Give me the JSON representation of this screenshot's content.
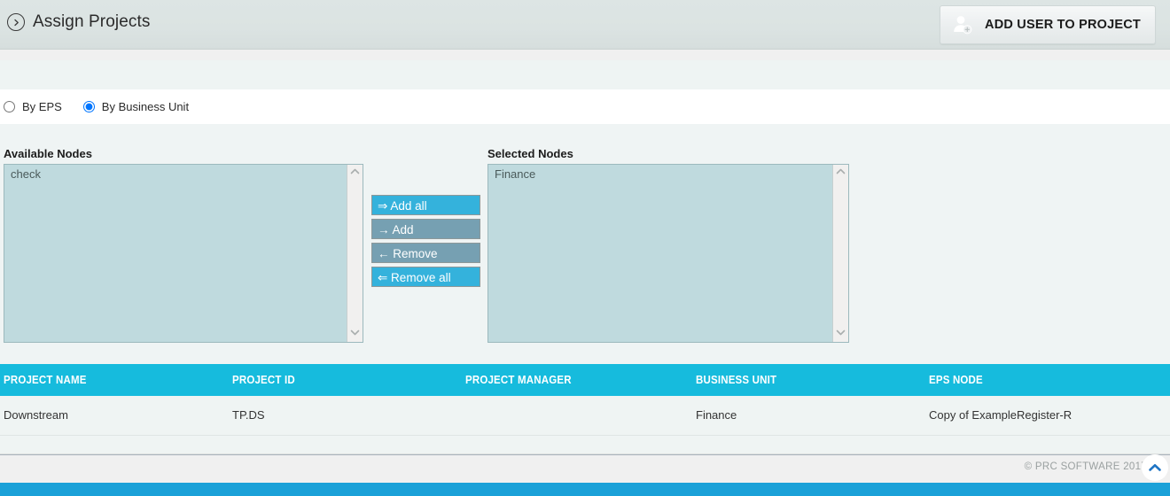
{
  "header": {
    "title": "Assign Projects",
    "back_icon": "chevron-right-circle-icon",
    "add_user_button": {
      "label": "ADD USER TO PROJECT",
      "icon": "add-user-icon"
    }
  },
  "filter": {
    "options": [
      {
        "label": "By EPS",
        "selected": false
      },
      {
        "label": "By Business Unit",
        "selected": true
      }
    ]
  },
  "transfer": {
    "available": {
      "label": "Available Nodes",
      "options": [
        "check"
      ]
    },
    "selected": {
      "label": "Selected Nodes",
      "options": [
        "Finance"
      ]
    },
    "buttons": [
      {
        "label": "⇒ Add all",
        "style": "primary"
      },
      {
        "label": "→ Add",
        "style": "muted"
      },
      {
        "label": "← Remove",
        "style": "muted"
      },
      {
        "label": "⇐ Remove all",
        "style": "primary"
      }
    ],
    "scrollbar": {
      "up_icon": "chevron-up-icon",
      "down_icon": "chevron-down-icon"
    }
  },
  "table": {
    "columns": [
      "PROJECT NAME",
      "PROJECT ID",
      "PROJECT MANAGER",
      "BUSINESS UNIT",
      "EPS NODE"
    ],
    "rows": [
      {
        "project_name": "Downstream",
        "project_id": "TP.DS",
        "project_manager": "",
        "business_unit": "Finance",
        "eps_node": "Copy of ExampleRegister-R"
      }
    ]
  },
  "footer": {
    "copyright": "© PRC SOFTWARE 2017",
    "to_top_icon": "chevron-up-icon"
  },
  "colors": {
    "accent_cyan": "#16bbdd",
    "button_primary": "#34b2dc",
    "button_muted": "#76a0b2",
    "listbox_bg": "#bfdade",
    "bottom_bar": "#1ba1d8",
    "header_bg": "#dbe3e2"
  }
}
